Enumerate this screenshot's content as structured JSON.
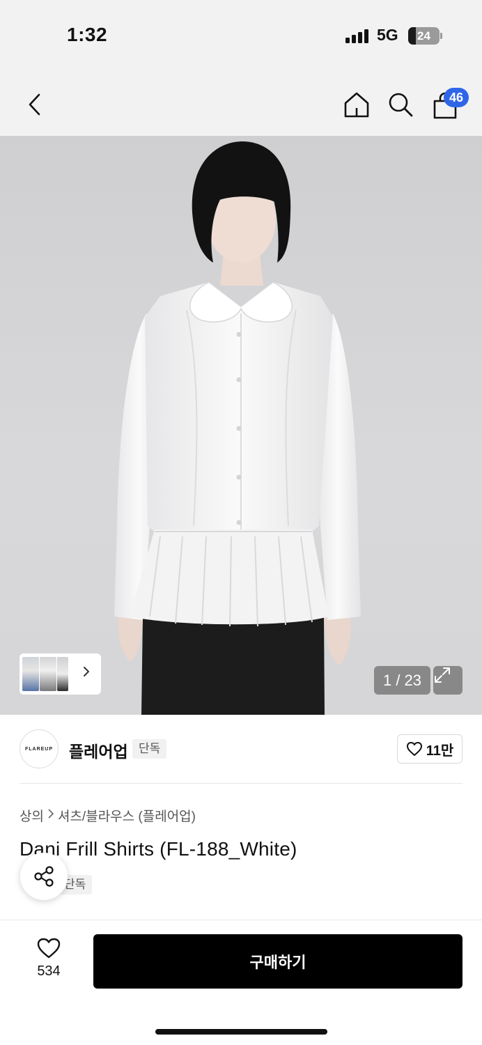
{
  "status_bar": {
    "time": "1:32",
    "network": "5G",
    "battery_level": 24,
    "battery_text": "24"
  },
  "top_nav": {
    "cart_badge": "46",
    "icons": [
      "back-chevron-icon",
      "home-icon",
      "search-icon",
      "shopping-bag-icon"
    ]
  },
  "gallery": {
    "counter": "1 / 23",
    "current_page": 1,
    "total_pages": 23
  },
  "brand": {
    "logo_text": "FLAREUP",
    "name": "플레어업",
    "tag": "단독",
    "like_count": "11만"
  },
  "product": {
    "breadcrumb": [
      "상의",
      "셔츠/블라우스 (플레어업)"
    ],
    "title": "Dani Frill Shirts (FL-188_White)",
    "tag": "단독"
  },
  "bottom_bar": {
    "wish_count": "534",
    "buy_label": "구매하기"
  },
  "colors": {
    "badge_blue": "#2f66e8",
    "buy_button": "#000000",
    "nav_background": "#f2f2f2"
  }
}
